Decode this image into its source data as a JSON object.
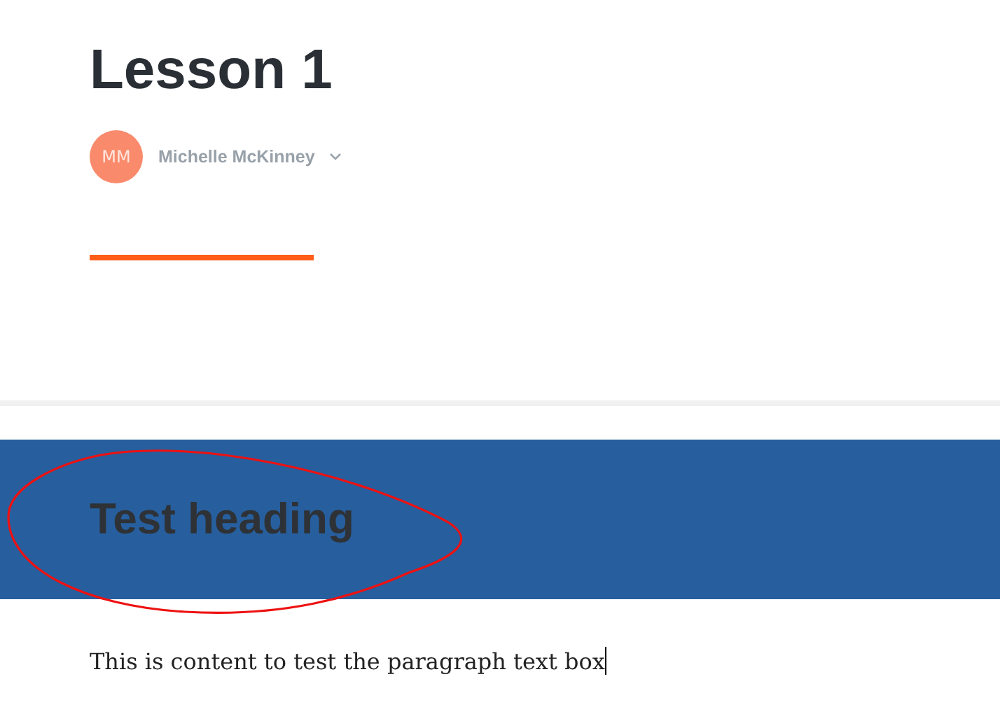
{
  "lesson": {
    "title": "Lesson 1",
    "author": {
      "initials": "MM",
      "name": "Michelle McKinney"
    }
  },
  "heading_block": {
    "heading": "Test heading"
  },
  "paragraph_block": {
    "text": "This is content to test the paragraph text box"
  }
}
